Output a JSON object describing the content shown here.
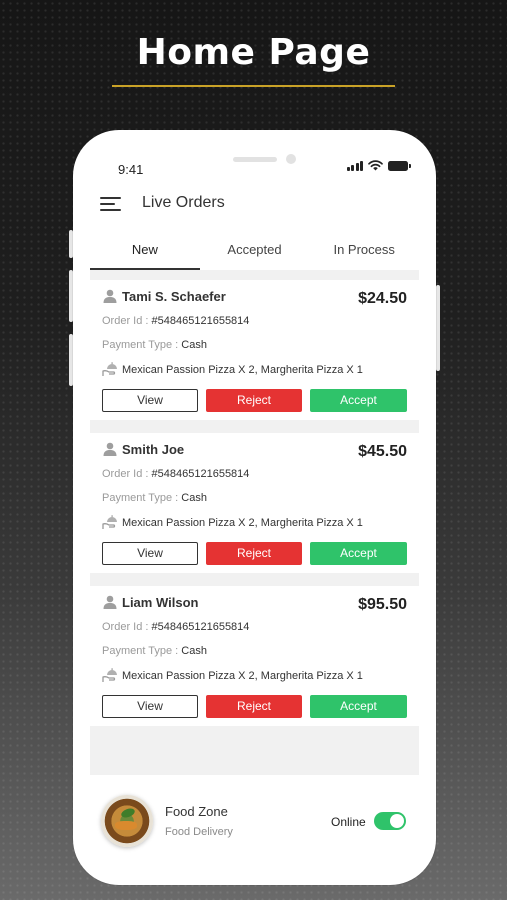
{
  "hero": {
    "title": "Home Page"
  },
  "status_bar": {
    "time": "9:41"
  },
  "header": {
    "title": "Live Orders"
  },
  "tabs": [
    {
      "label": "New",
      "active": true
    },
    {
      "label": "Accepted",
      "active": false
    },
    {
      "label": "In Process",
      "active": false
    }
  ],
  "labels": {
    "order_id": "Order Id :",
    "payment_type": "Payment Type :"
  },
  "orders": [
    {
      "customer": "Tami S. Schaefer",
      "price": "$24.50",
      "order_id": "#548465121655814",
      "payment": "Cash",
      "items": "Mexican Passion Pizza X 2, Margherita Pizza X 1",
      "view_label": "View",
      "reject_label": "Reject",
      "accept_label": "Accept"
    },
    {
      "customer": "Smith Joe",
      "price": "$45.50",
      "order_id": "#548465121655814",
      "payment": "Cash",
      "items": "Mexican Passion Pizza X 2, Margherita Pizza X 1",
      "view_label": "View",
      "reject_label": "Reject",
      "accept_label": "Accept"
    },
    {
      "customer": "Liam Wilson",
      "price": "$95.50",
      "order_id": "#548465121655814",
      "payment": "Cash",
      "items": "Mexican Passion Pizza X 2, Margherita Pizza X 1",
      "view_label": "View",
      "reject_label": "Reject",
      "accept_label": "Accept"
    }
  ],
  "footer": {
    "shop_name": "Food Zone",
    "shop_subtitle": "Food Delivery",
    "status_label": "Online",
    "online": true
  },
  "colors": {
    "accent_underline": "#c9a227",
    "reject": "#e53333",
    "accept": "#2fc36a",
    "toggle_on": "#2fc36a"
  },
  "icons": {
    "menu": "hamburger-menu-icon",
    "person": "person-icon",
    "dish": "serving-hand-icon",
    "signal": "signal-icon",
    "wifi": "wifi-icon",
    "battery": "battery-icon"
  }
}
